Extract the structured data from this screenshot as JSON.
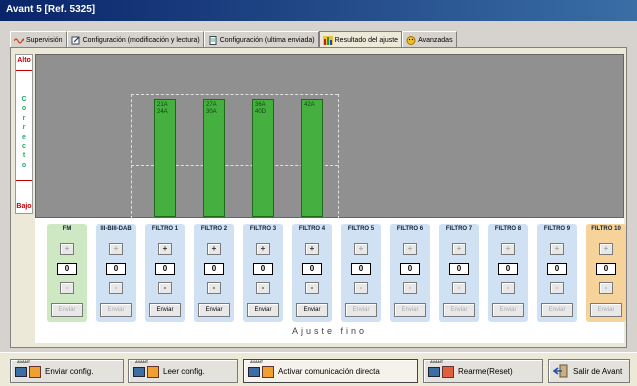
{
  "window": {
    "title": "Avant 5 [Ref. 5325]"
  },
  "tabs": [
    {
      "label": "Supervisión",
      "icon": "wave-icon"
    },
    {
      "label": "Configuración (modificación y lectura)",
      "icon": "edit-icon"
    },
    {
      "label": "Configuración (ultima enviada)",
      "icon": "file-icon"
    },
    {
      "label": "Resultado del ajuste",
      "icon": "bars-chart-icon",
      "active": true
    },
    {
      "label": "Avanzadas",
      "icon": "smiley-icon"
    }
  ],
  "scale": {
    "top": "Alto",
    "middle": "Correcto",
    "bottom": "Bajo"
  },
  "bars": [
    {
      "label": "21A\n24A",
      "level": 0.73,
      "column": 2
    },
    {
      "label": "27A\n30A",
      "level": 0.73,
      "column": 3
    },
    {
      "label": "36A\n40D",
      "level": 0.73,
      "column": 4
    },
    {
      "label": "42A",
      "level": 0.73,
      "column": 5
    }
  ],
  "columns": [
    {
      "name": "FM",
      "value": "0",
      "send": "Enviar",
      "enabled": false,
      "color": "#cde8c3"
    },
    {
      "name": "III-BIII-DAB",
      "value": "0",
      "send": "Enviar",
      "enabled": false,
      "color": "#cfe1f2"
    },
    {
      "name": "FILTRO 1",
      "value": "0",
      "send": "Enviar",
      "enabled": true,
      "color": "#cfe1f2"
    },
    {
      "name": "FILTRO 2",
      "value": "0",
      "send": "Enviar",
      "enabled": true,
      "color": "#cfe1f2"
    },
    {
      "name": "FILTRO 3",
      "value": "0",
      "send": "Enviar",
      "enabled": true,
      "color": "#cfe1f2"
    },
    {
      "name": "FILTRO 4",
      "value": "0",
      "send": "Enviar",
      "enabled": true,
      "color": "#cfe1f2"
    },
    {
      "name": "FILTRO 5",
      "value": "0",
      "send": "Enviar",
      "enabled": false,
      "color": "#cfe1f2"
    },
    {
      "name": "FILTRO 6",
      "value": "0",
      "send": "Enviar",
      "enabled": false,
      "color": "#cfe1f2"
    },
    {
      "name": "FILTRO 7",
      "value": "0",
      "send": "Enviar",
      "enabled": false,
      "color": "#cfe1f2"
    },
    {
      "name": "FILTRO 8",
      "value": "0",
      "send": "Enviar",
      "enabled": false,
      "color": "#cfe1f2"
    },
    {
      "name": "FILTRO 9",
      "value": "0",
      "send": "Enviar",
      "enabled": false,
      "color": "#cfe1f2"
    },
    {
      "name": "FILTRO 10",
      "value": "0",
      "send": "Enviar",
      "enabled": false,
      "color": "#f6d39a"
    }
  ],
  "fine_tune_label": "Ajuste fino",
  "toolbar": [
    {
      "label": "Enviar config.",
      "tag": "AVANT",
      "icon": "send-config-icon"
    },
    {
      "label": "Leer config.",
      "tag": "AVANT",
      "icon": "read-config-icon"
    },
    {
      "label": "Activar comunicación directa",
      "tag": "AVANT",
      "icon": "direct-comm-icon",
      "active": true
    },
    {
      "label": "Rearme(Reset)",
      "tag": "AVANT",
      "icon": "reset-icon"
    },
    {
      "label": "Salir de Avant",
      "icon": "exit-icon"
    }
  ]
}
